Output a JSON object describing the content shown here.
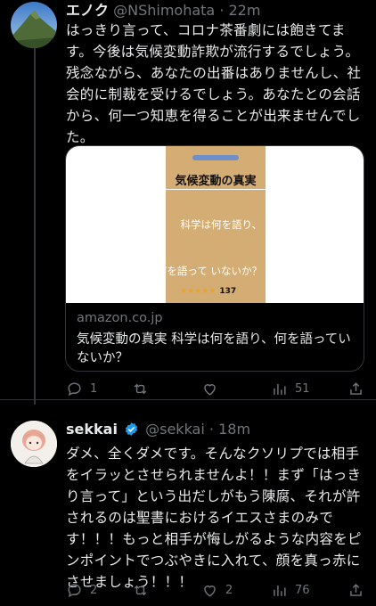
{
  "tweets": [
    {
      "name": "エノク",
      "handle": "@NShimohata",
      "time": "22m",
      "text": "はっきり言って、コロナ茶番劇には飽きてます。今後は気候変動詐欺が流行するでしょう。残念ながら、あなたの出番はありませんし、社会的に制裁を受けるでしょう。あなたとの会話から、何一つ知恵を得ることが出来ませんでした。",
      "card": {
        "domain": "amazon.co.jp",
        "title": "気候変動の真実 科学は何を語り、何を語っていないか？",
        "book_title": "気候変動の真実",
        "book_sub1": "科学は何を語り、",
        "book_sub2": "何を語って いないか？",
        "rating_count": "137"
      },
      "actions": {
        "reply": "1",
        "retweet": "",
        "like": "",
        "views": "51"
      }
    },
    {
      "name": "sekkai",
      "handle": "@sekkai",
      "time": "18m",
      "text": "ダメ、全くダメです。そんなクソリプでは相手をイラッとさせられませんよ！！まず「はっきり言って」という出だしがもう陳腐、それが許されるのは聖書におけるイエスさまのみです！！！もっと相手が悔しがるような内容をピンポイントでつぶやきに入れて、顔を真っ赤にさせましょう！！！",
      "actions": {
        "reply": "2",
        "retweet": "",
        "like": "2",
        "views": "76"
      }
    }
  ],
  "colors": {
    "bg": "#000000",
    "text": "#e7e9ea",
    "muted": "#71767b",
    "verified": "#1d9bf0"
  },
  "icons": [
    "reply-icon",
    "retweet-icon",
    "like-icon",
    "views-icon",
    "share-icon",
    "verified-icon"
  ]
}
